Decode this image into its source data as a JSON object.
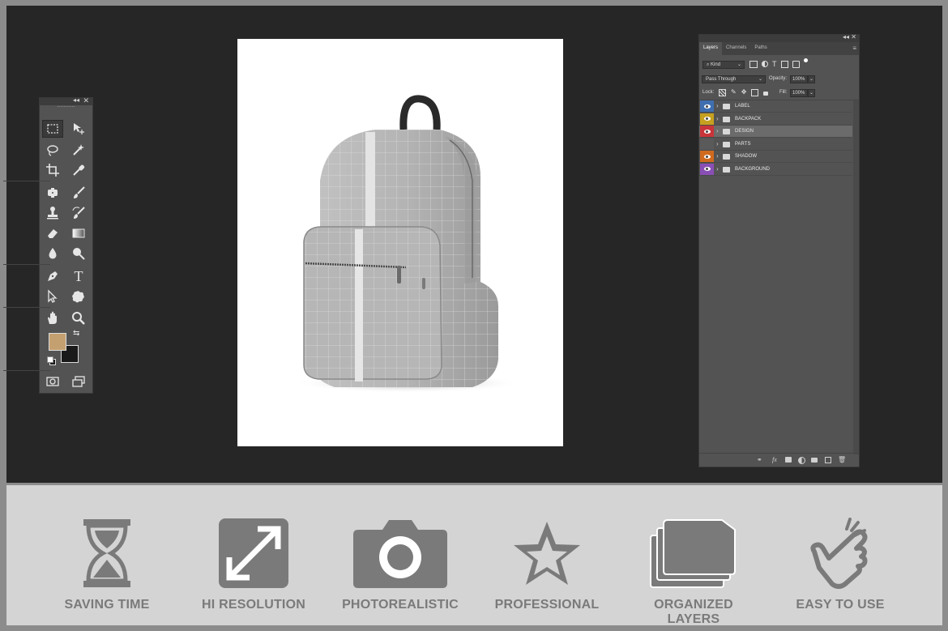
{
  "toolbox": {
    "collapse_glyph": "◂◂",
    "close_glyph": "✕",
    "tools": [
      {
        "name": "rectangular-marquee-icon"
      },
      {
        "name": "move-tool-icon"
      },
      {
        "name": "lasso-icon"
      },
      {
        "name": "magic-wand-icon"
      },
      {
        "name": "crop-icon"
      },
      {
        "name": "eyedropper-icon"
      },
      {
        "name": "spot-healing-icon"
      },
      {
        "name": "brush-icon"
      },
      {
        "name": "clone-stamp-icon"
      },
      {
        "name": "history-brush-icon"
      },
      {
        "name": "eraser-icon"
      },
      {
        "name": "gradient-icon"
      },
      {
        "name": "blur-icon"
      },
      {
        "name": "dodge-icon"
      },
      {
        "name": "pen-icon"
      },
      {
        "name": "type-icon"
      },
      {
        "name": "path-selection-icon"
      },
      {
        "name": "custom-shape-icon"
      },
      {
        "name": "hand-icon"
      },
      {
        "name": "zoom-icon"
      }
    ],
    "type_glyph": "T",
    "foreground_color": "#c4a070",
    "background_color": "#1a1a1a"
  },
  "layers_panel": {
    "collapse_glyph": "◂◂",
    "close_glyph": "✕",
    "tabs": [
      "Layers",
      "Channels",
      "Paths"
    ],
    "active_tab": "Layers",
    "menu_glyph": "≡",
    "filter_label": "Kind",
    "blend_mode": "Pass Through",
    "opacity_label": "Opacity:",
    "opacity_value": "100%",
    "lock_label": "Lock:",
    "fill_label": "Fill:",
    "fill_value": "100%",
    "layers": [
      {
        "name": "LABEL",
        "color": "#3f6fb0",
        "visible": true,
        "selected": false
      },
      {
        "name": "BACKPACK",
        "color": "#c6a020",
        "visible": true,
        "selected": false
      },
      {
        "name": "DESIGN",
        "color": "#c8353a",
        "visible": true,
        "selected": true
      },
      {
        "name": "PARTS",
        "color": "#5a5a5a",
        "visible": false,
        "selected": false
      },
      {
        "name": "SHADOW",
        "color": "#d06a1e",
        "visible": true,
        "selected": false
      },
      {
        "name": "BACKGROUND",
        "color": "#8a4fb5",
        "visible": true,
        "selected": false
      }
    ],
    "footer_icons": [
      "link-icon",
      "fx-icon",
      "mask-icon",
      "adjustment-icon",
      "group-folder-icon",
      "new-layer-icon",
      "trash-icon"
    ],
    "footer_fx_text": "fx"
  },
  "features": [
    {
      "label": "SAVING TIME",
      "icon": "hourglass-icon"
    },
    {
      "label": "HI RESOLUTION",
      "icon": "expand-arrows-icon"
    },
    {
      "label": "PHOTOREALISTIC",
      "icon": "camera-icon"
    },
    {
      "label": "PROFESSIONAL",
      "icon": "star-icon"
    },
    {
      "label": "ORGANIZED LAYERS",
      "icon": "stacked-folders-icon"
    },
    {
      "label": "EASY TO USE",
      "icon": "pointing-hand-icon"
    }
  ],
  "colors": {
    "frame": "#8c8c8c",
    "workspace": "#262626",
    "panel": "#535353",
    "feature_icon": "#7a7a7a"
  }
}
